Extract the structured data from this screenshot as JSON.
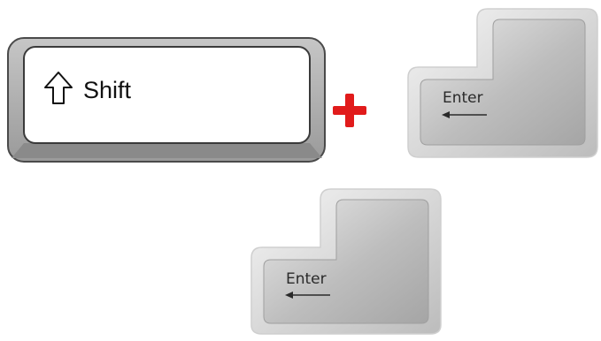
{
  "shift_key": {
    "label": "Shift",
    "icon": "up-arrow-outline-icon",
    "fill_color": "#d2d2d2",
    "face_color": "#ffffff",
    "border_color": "#555555"
  },
  "combo_operator": {
    "symbol": "plus-sign",
    "color": "#e11b1b"
  },
  "enter_key_top": {
    "label": "Enter",
    "icon": "left-arrow-icon"
  },
  "enter_key_bottom": {
    "label": "Enter",
    "icon": "left-arrow-icon"
  }
}
